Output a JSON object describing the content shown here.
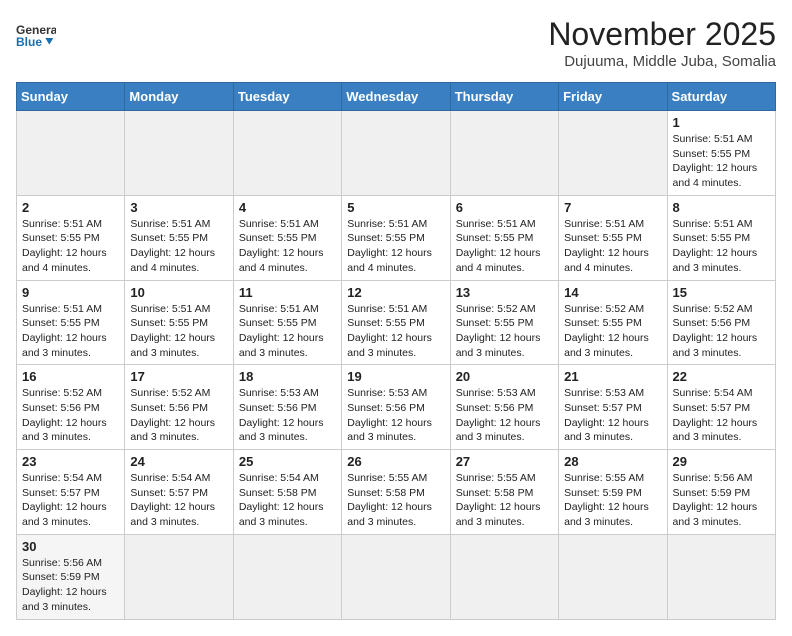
{
  "header": {
    "logo_general": "General",
    "logo_blue": "Blue",
    "month_title": "November 2025",
    "location": "Dujuuma, Middle Juba, Somalia"
  },
  "weekdays": [
    "Sunday",
    "Monday",
    "Tuesday",
    "Wednesday",
    "Thursday",
    "Friday",
    "Saturday"
  ],
  "weeks": [
    [
      null,
      null,
      null,
      null,
      null,
      null,
      {
        "day": "1",
        "sunrise": "5:51 AM",
        "sunset": "5:55 PM",
        "daylight": "12 hours and 4 minutes."
      }
    ],
    [
      {
        "day": "2",
        "sunrise": "5:51 AM",
        "sunset": "5:55 PM",
        "daylight": "12 hours and 4 minutes."
      },
      {
        "day": "3",
        "sunrise": "5:51 AM",
        "sunset": "5:55 PM",
        "daylight": "12 hours and 4 minutes."
      },
      {
        "day": "4",
        "sunrise": "5:51 AM",
        "sunset": "5:55 PM",
        "daylight": "12 hours and 4 minutes."
      },
      {
        "day": "5",
        "sunrise": "5:51 AM",
        "sunset": "5:55 PM",
        "daylight": "12 hours and 4 minutes."
      },
      {
        "day": "6",
        "sunrise": "5:51 AM",
        "sunset": "5:55 PM",
        "daylight": "12 hours and 4 minutes."
      },
      {
        "day": "7",
        "sunrise": "5:51 AM",
        "sunset": "5:55 PM",
        "daylight": "12 hours and 4 minutes."
      },
      {
        "day": "8",
        "sunrise": "5:51 AM",
        "sunset": "5:55 PM",
        "daylight": "12 hours and 3 minutes."
      }
    ],
    [
      {
        "day": "9",
        "sunrise": "5:51 AM",
        "sunset": "5:55 PM",
        "daylight": "12 hours and 3 minutes."
      },
      {
        "day": "10",
        "sunrise": "5:51 AM",
        "sunset": "5:55 PM",
        "daylight": "12 hours and 3 minutes."
      },
      {
        "day": "11",
        "sunrise": "5:51 AM",
        "sunset": "5:55 PM",
        "daylight": "12 hours and 3 minutes."
      },
      {
        "day": "12",
        "sunrise": "5:51 AM",
        "sunset": "5:55 PM",
        "daylight": "12 hours and 3 minutes."
      },
      {
        "day": "13",
        "sunrise": "5:52 AM",
        "sunset": "5:55 PM",
        "daylight": "12 hours and 3 minutes."
      },
      {
        "day": "14",
        "sunrise": "5:52 AM",
        "sunset": "5:55 PM",
        "daylight": "12 hours and 3 minutes."
      },
      {
        "day": "15",
        "sunrise": "5:52 AM",
        "sunset": "5:56 PM",
        "daylight": "12 hours and 3 minutes."
      }
    ],
    [
      {
        "day": "16",
        "sunrise": "5:52 AM",
        "sunset": "5:56 PM",
        "daylight": "12 hours and 3 minutes."
      },
      {
        "day": "17",
        "sunrise": "5:52 AM",
        "sunset": "5:56 PM",
        "daylight": "12 hours and 3 minutes."
      },
      {
        "day": "18",
        "sunrise": "5:53 AM",
        "sunset": "5:56 PM",
        "daylight": "12 hours and 3 minutes."
      },
      {
        "day": "19",
        "sunrise": "5:53 AM",
        "sunset": "5:56 PM",
        "daylight": "12 hours and 3 minutes."
      },
      {
        "day": "20",
        "sunrise": "5:53 AM",
        "sunset": "5:56 PM",
        "daylight": "12 hours and 3 minutes."
      },
      {
        "day": "21",
        "sunrise": "5:53 AM",
        "sunset": "5:57 PM",
        "daylight": "12 hours and 3 minutes."
      },
      {
        "day": "22",
        "sunrise": "5:54 AM",
        "sunset": "5:57 PM",
        "daylight": "12 hours and 3 minutes."
      }
    ],
    [
      {
        "day": "23",
        "sunrise": "5:54 AM",
        "sunset": "5:57 PM",
        "daylight": "12 hours and 3 minutes."
      },
      {
        "day": "24",
        "sunrise": "5:54 AM",
        "sunset": "5:57 PM",
        "daylight": "12 hours and 3 minutes."
      },
      {
        "day": "25",
        "sunrise": "5:54 AM",
        "sunset": "5:58 PM",
        "daylight": "12 hours and 3 minutes."
      },
      {
        "day": "26",
        "sunrise": "5:55 AM",
        "sunset": "5:58 PM",
        "daylight": "12 hours and 3 minutes."
      },
      {
        "day": "27",
        "sunrise": "5:55 AM",
        "sunset": "5:58 PM",
        "daylight": "12 hours and 3 minutes."
      },
      {
        "day": "28",
        "sunrise": "5:55 AM",
        "sunset": "5:59 PM",
        "daylight": "12 hours and 3 minutes."
      },
      {
        "day": "29",
        "sunrise": "5:56 AM",
        "sunset": "5:59 PM",
        "daylight": "12 hours and 3 minutes."
      }
    ],
    [
      {
        "day": "30",
        "sunrise": "5:56 AM",
        "sunset": "5:59 PM",
        "daylight": "12 hours and 3 minutes."
      },
      null,
      null,
      null,
      null,
      null,
      null
    ]
  ]
}
